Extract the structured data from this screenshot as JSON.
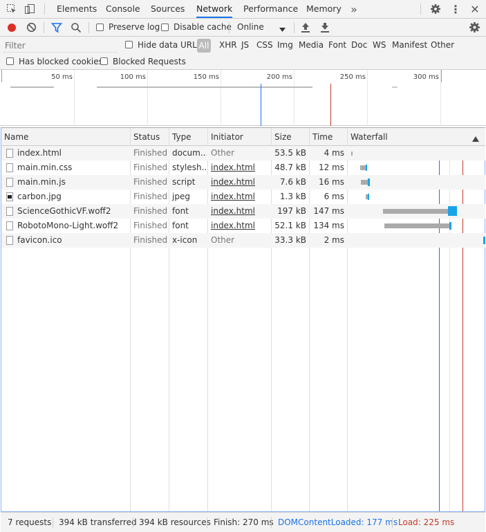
{
  "tabs": [
    {
      "label": "Elements"
    },
    {
      "label": "Console"
    },
    {
      "label": "Sources"
    },
    {
      "label": "Network"
    },
    {
      "label": "Performance"
    },
    {
      "label": "Memory"
    }
  ],
  "toolbar": {
    "preserve_log": "Preserve log",
    "disable_cache": "Disable cache",
    "throttle_value": "Online"
  },
  "filter": {
    "placeholder": "Filter",
    "hide_data_urls": "Hide data URLs",
    "types": [
      "All",
      "XHR",
      "JS",
      "CSS",
      "Img",
      "Media",
      "Font",
      "Doc",
      "WS",
      "Manifest",
      "Other"
    ],
    "has_blocked_cookies": "Has blocked cookies",
    "blocked_requests": "Blocked Requests"
  },
  "overview": {
    "ticks": [
      "50 ms",
      "100 ms",
      "150 ms",
      "200 ms",
      "250 ms",
      "300 ms"
    ],
    "dom_ms": 177,
    "load_ms": 225,
    "dom_color": "#1a73e8",
    "load_color": "#c0392b"
  },
  "columns": {
    "name": "Name",
    "status": "Status",
    "type": "Type",
    "initiator": "Initiator",
    "size": "Size",
    "time": "Time",
    "waterfall": "Waterfall"
  },
  "requests": [
    {
      "name": "index.html",
      "status": "Finished",
      "type": "docum...",
      "initiator": "Other",
      "initiator_link": false,
      "size": "53.5 kB",
      "time": "4 ms",
      "icon": "document-file-icon"
    },
    {
      "name": "main.min.css",
      "status": "Finished",
      "type": "stylesh...",
      "initiator": "index.html",
      "initiator_link": true,
      "size": "48.7 kB",
      "time": "12 ms",
      "icon": "stylesheet-file-icon"
    },
    {
      "name": "main.min.js",
      "status": "Finished",
      "type": "script",
      "initiator": "index.html",
      "initiator_link": true,
      "size": "7.6 kB",
      "time": "16 ms",
      "icon": "script-file-icon"
    },
    {
      "name": "carbon.jpg",
      "status": "Finished",
      "type": "jpeg",
      "initiator": "index.html",
      "initiator_link": true,
      "size": "1.3 kB",
      "time": "6 ms",
      "icon": "image-file-icon"
    },
    {
      "name": "ScienceGothicVF.woff2",
      "status": "Finished",
      "type": "font",
      "initiator": "index.html",
      "initiator_link": true,
      "size": "197 kB",
      "time": "147 ms",
      "icon": "font-file-icon"
    },
    {
      "name": "RobotoMono-Light.woff2",
      "status": "Finished",
      "type": "font",
      "initiator": "index.html",
      "initiator_link": true,
      "size": "52.1 kB",
      "time": "134 ms",
      "icon": "font-file-icon"
    },
    {
      "name": "favicon.ico",
      "status": "Finished",
      "type": "x-icon",
      "initiator": "Other",
      "initiator_link": false,
      "size": "33.3 kB",
      "time": "2 ms",
      "icon": "icon-file-icon"
    }
  ],
  "statusbar": {
    "requests": "7 requests",
    "transferred": "394 kB transferred",
    "resources": "394 kB resources",
    "finish": "Finish: 270 ms",
    "dom_content_loaded": "DOMContentLoaded: 177 ms",
    "load": "Load: 225 ms"
  }
}
